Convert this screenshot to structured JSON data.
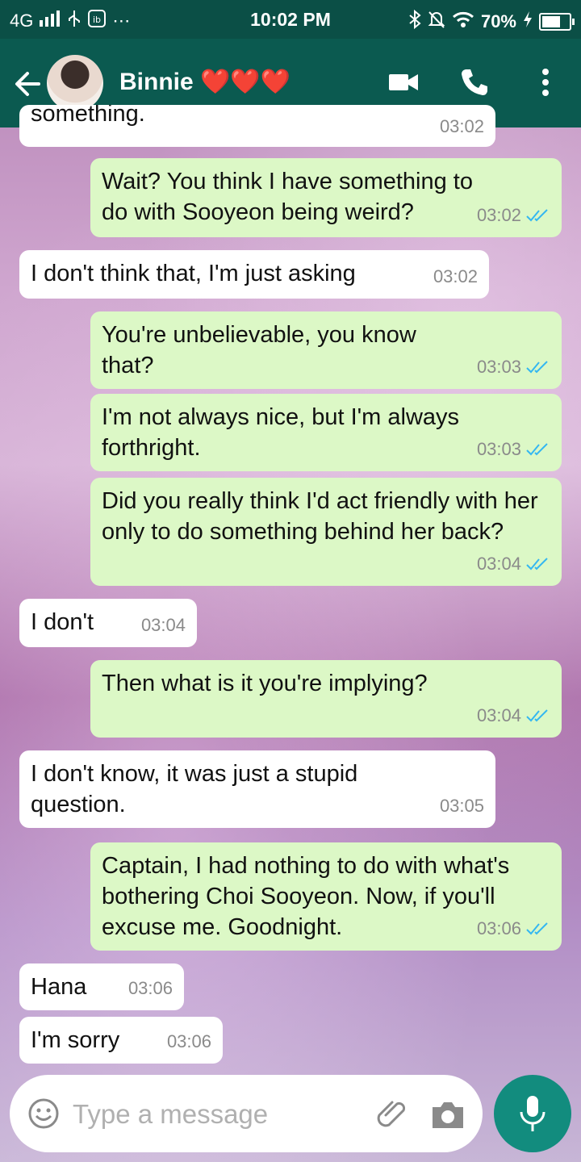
{
  "status_bar": {
    "network": "4G",
    "time": "10:02 PM",
    "battery": "70%",
    "battery_level": 0.7
  },
  "header": {
    "contact_name": "Binnie ❤️❤️❤️",
    "icons": [
      "back-arrow-icon",
      "video-call-icon",
      "phone-icon",
      "more-vert-icon"
    ],
    "color": "#0b5a50"
  },
  "messages": [
    {
      "dir": "in",
      "text": "something.",
      "time": "03:02"
    },
    {
      "dir": "out",
      "text": "Wait? You think I have something to do with Sooyeon being weird?",
      "time": "03:02"
    },
    {
      "dir": "in",
      "text": "I don't think that, I'm just asking",
      "time": "03:02"
    },
    {
      "dir": "out",
      "text": "You're unbelievable, you know that?",
      "time": "03:03"
    },
    {
      "dir": "out",
      "text": "I'm not always nice, but I'm always forthright.",
      "time": "03:03"
    },
    {
      "dir": "out",
      "text": "Did you really think I'd act friendly with her only to do something behind her back?",
      "time": "03:04"
    },
    {
      "dir": "in",
      "text": "I don't",
      "time": "03:04"
    },
    {
      "dir": "out",
      "text": "Then what is it you're implying?",
      "time": "03:04"
    },
    {
      "dir": "in",
      "text": "I don't know, it was just a stupid question.",
      "time": "03:05"
    },
    {
      "dir": "out",
      "text": "Captain, I had nothing to do with what's bothering Choi Sooyeon. Now, if you'll excuse me. Goodnight.",
      "time": "03:06"
    },
    {
      "dir": "in",
      "text": "Hana",
      "time": "03:06"
    },
    {
      "dir": "in",
      "text": "I'm sorry",
      "time": "03:06"
    }
  ],
  "composer": {
    "placeholder": "Type a message"
  },
  "colors": {
    "outgoing_bubble": "#dcf8c6",
    "incoming_bubble": "#ffffff",
    "read_tick": "#34b7f1",
    "fab": "#128c7e"
  }
}
